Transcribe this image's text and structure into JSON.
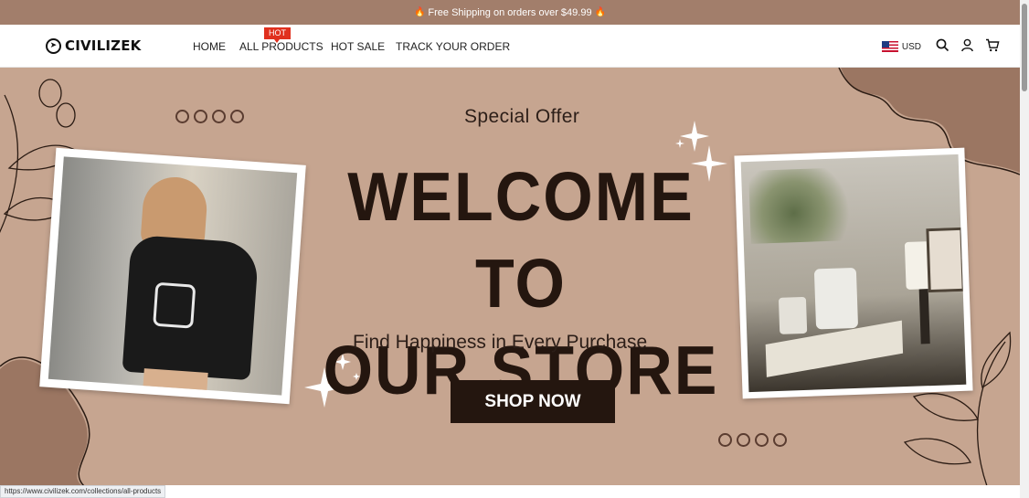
{
  "announcement": {
    "icon": "fire-icon",
    "text": "Free Shipping on orders over $49.99"
  },
  "brand": {
    "name": "CIVILIZEK"
  },
  "nav": {
    "items": [
      {
        "label": "HOME"
      },
      {
        "label": "ALL PRODUCTS",
        "badge": "HOT"
      },
      {
        "label": "HOT SALE"
      },
      {
        "label": "TRACK YOUR ORDER"
      }
    ]
  },
  "tools": {
    "currency": "USD",
    "icons": [
      "us-flag-icon",
      "search-icon",
      "account-icon",
      "cart-icon"
    ]
  },
  "hero": {
    "special": "Special Offer",
    "title_line1": "WELCOME TO",
    "title_line2": "OUR STORE",
    "tagline": "Find Happiness in Every Purchase",
    "cta": "SHOP NOW",
    "left_photo": "woman in black graphic t-shirt",
    "right_photo": "white candles on books with plants"
  },
  "status_bar": {
    "url": "https://www.civilizek.com/collections/all-products"
  },
  "colors": {
    "announcement_bg": "#a27e6b",
    "hero_bg": "#c6a590",
    "dark": "#24160f",
    "hot_badge": "#e0301e"
  }
}
